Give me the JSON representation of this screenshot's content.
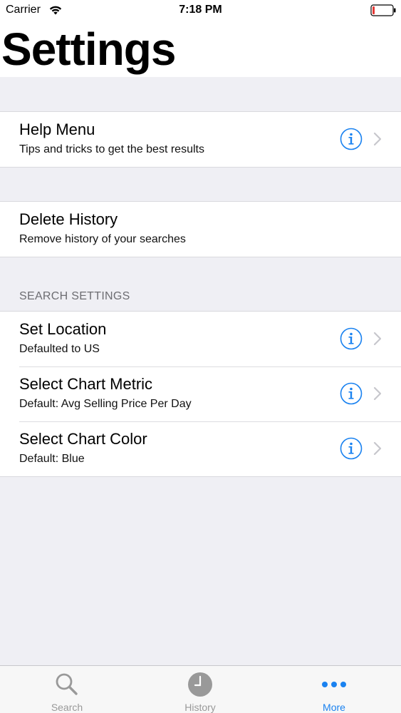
{
  "status_bar": {
    "carrier": "Carrier",
    "time": "7:18 PM"
  },
  "header": {
    "title": "Settings"
  },
  "groups": {
    "help": {
      "title": "Help Menu",
      "subtitle": "Tips and tricks to get the best results"
    },
    "history": {
      "title": "Delete History",
      "subtitle": "Remove history of your searches"
    },
    "search_settings": {
      "header": "SEARCH SETTINGS",
      "items": [
        {
          "title": "Set Location",
          "subtitle": "Defaulted to US"
        },
        {
          "title": "Select Chart Metric",
          "subtitle": "Default: Avg Selling Price Per Day"
        },
        {
          "title": "Select Chart Color",
          "subtitle": "Default: Blue"
        }
      ]
    }
  },
  "tab_bar": {
    "tabs": [
      {
        "label": "Search",
        "icon": "search-icon",
        "active": false
      },
      {
        "label": "History",
        "icon": "clock-icon",
        "active": false
      },
      {
        "label": "More",
        "icon": "more-icon",
        "active": true
      }
    ]
  },
  "colors": {
    "accent": "#1a82f0",
    "background": "#efeff4",
    "battery_low": "#e53935"
  }
}
